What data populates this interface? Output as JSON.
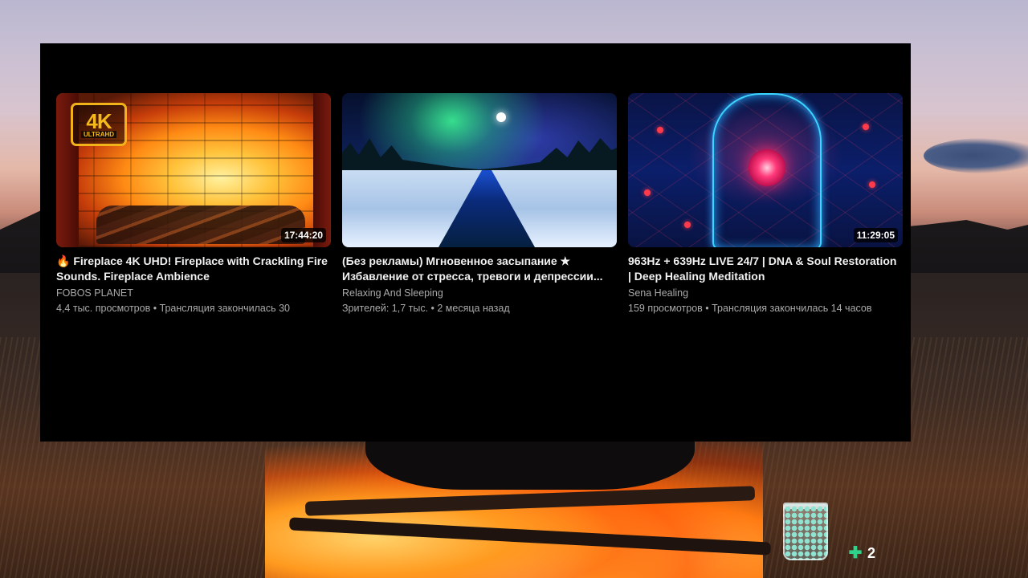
{
  "videos": [
    {
      "title": "🔥 Fireplace 4K UHD! Fireplace with Crackling Fire Sounds. Fireplace Ambience",
      "channel": "FOBOS PLANET",
      "meta": "4,4 тыс. просмотров • Трансляция закончилась 30",
      "duration": "17:44:20",
      "badge_main": "4K",
      "badge_sub": "ULTRAHD"
    },
    {
      "title": "(Без рекламы) Мгновенное засыпание ★ Избавление от стресса, тревоги и депрессии...",
      "channel": "Relaxing And Sleeping",
      "meta": "Зрителей: 1,7 тыс. • 2 месяца назад",
      "duration": ""
    },
    {
      "title": "963Hz + 639Hz LIVE 24/7 | DNA & Soul Restoration | Deep Healing Meditation",
      "channel": "Sena Healing",
      "meta": "159 просмотров • Трансляция закончилась 14 часов",
      "duration": "11:29:05"
    }
  ],
  "widgets": {
    "counter_value": "2",
    "counter_icon": "puzzle-icon"
  }
}
